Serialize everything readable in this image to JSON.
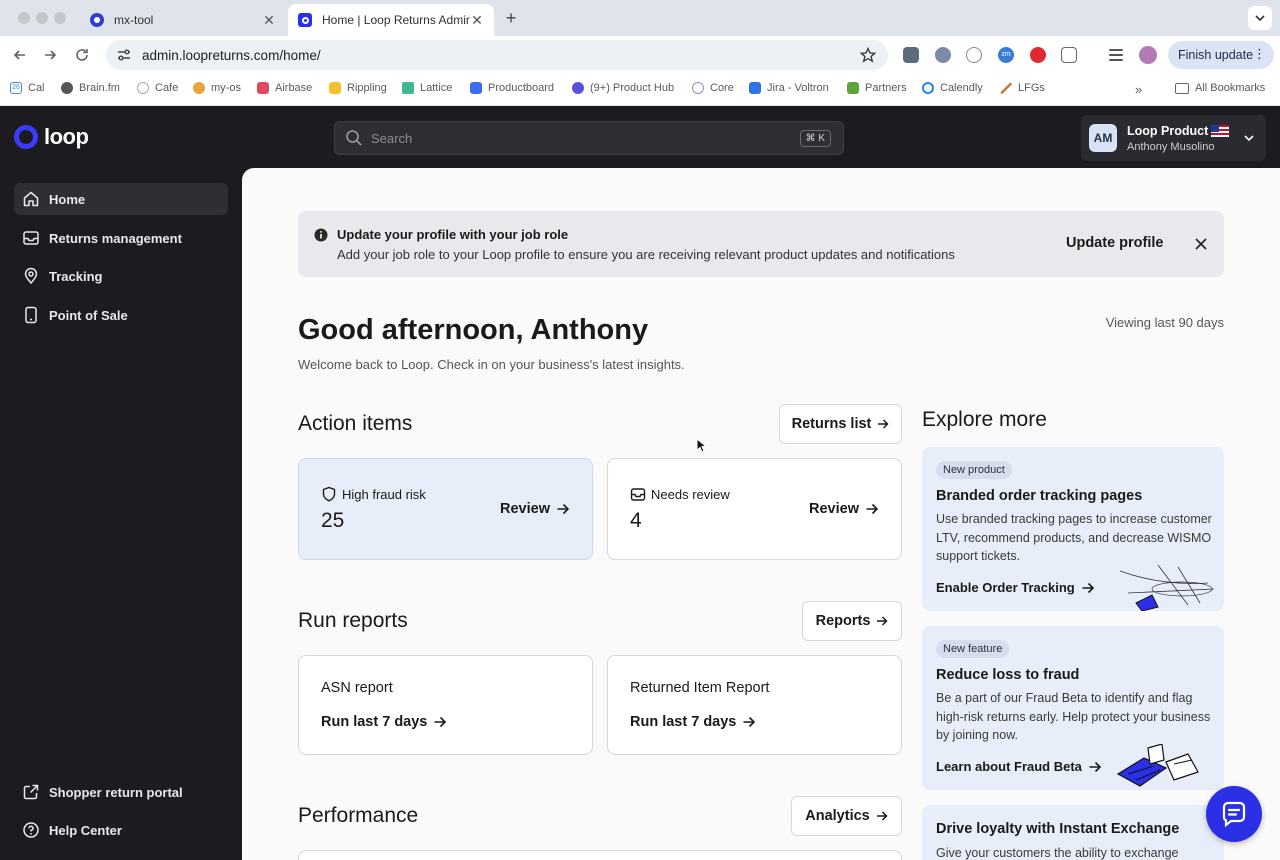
{
  "browser": {
    "tabs": [
      {
        "title": "mx-tool",
        "icon": "mx-tool-favicon"
      },
      {
        "title": "Home | Loop Returns Admin",
        "icon": "loop-favicon"
      }
    ],
    "url": "admin.loopreturns.com/home/",
    "finish_update_label": "Finish update",
    "bookmarks": [
      "Cal",
      "Brain.fm",
      "Cafe",
      "my-os",
      "Airbase",
      "Rippling",
      "Lattice",
      "Productboard",
      "(9+) Product Hub",
      "Core",
      "Jira - Voltron",
      "Partners",
      "Calendly",
      "LFGs"
    ],
    "all_bookmarks_label": "All Bookmarks",
    "bookmark_icon_text": {
      "cal": "26"
    },
    "extension_icon_text": {
      "zm": "zm"
    }
  },
  "app": {
    "logo_text": "loop",
    "search_placeholder": "Search",
    "search_shortcut": "⌘ K",
    "account": {
      "initials": "AM",
      "org": "Loop Product",
      "user": "Anthony Musolino"
    },
    "nav": [
      {
        "label": "Home",
        "icon": "home-icon",
        "active": true
      },
      {
        "label": "Returns management",
        "icon": "inbox-icon"
      },
      {
        "label": "Tracking",
        "icon": "location-pin-icon"
      },
      {
        "label": "Point of Sale",
        "icon": "tablet-icon"
      }
    ],
    "nav_bottom": [
      {
        "label": "Shopper return portal",
        "icon": "external-link-icon"
      },
      {
        "label": "Help Center",
        "icon": "help-circle-icon"
      }
    ]
  },
  "banner": {
    "title": "Update your profile with your job role",
    "body": "Add your job role to your Loop profile to ensure you are receiving relevant product updates and notifications",
    "button": "Update profile"
  },
  "header": {
    "greeting": "Good afternoon, Anthony",
    "welcome": "Welcome back to Loop. Check in on your business's latest insights.",
    "viewing": "Viewing last 90 days"
  },
  "action_items": {
    "title": "Action items",
    "button": "Returns list",
    "cards": [
      {
        "title": "High fraud risk",
        "value": "25",
        "action": "Review"
      },
      {
        "title": "Needs review",
        "value": "4",
        "action": "Review"
      }
    ]
  },
  "reports": {
    "title": "Run reports",
    "button": "Reports",
    "cards": [
      {
        "title": "ASN report",
        "action": "Run last 7 days"
      },
      {
        "title": "Returned Item Report",
        "action": "Run last 7 days"
      }
    ]
  },
  "performance": {
    "title": "Performance",
    "button": "Analytics"
  },
  "explore": {
    "title": "Explore more",
    "promos": [
      {
        "badge": "New product",
        "title": "Branded order tracking pages",
        "body": "Use branded tracking pages to increase customer LTV, recommend products, and decrease WISMO support tickets.",
        "link": "Enable Order Tracking"
      },
      {
        "badge": "New feature",
        "title": "Reduce loss to fraud",
        "body": "Be a part of our Fraud Beta to identify and flag high-risk returns early. Help protect your business by joining now.",
        "link": "Learn about Fraud Beta"
      },
      {
        "title": "Drive loyalty with Instant Exchange",
        "body": "Give your customers the ability to exchange"
      }
    ]
  },
  "colors": {
    "brand": "#3b3bff",
    "sidebar": "#1c1c20",
    "card_blue": "#e8eef9"
  }
}
